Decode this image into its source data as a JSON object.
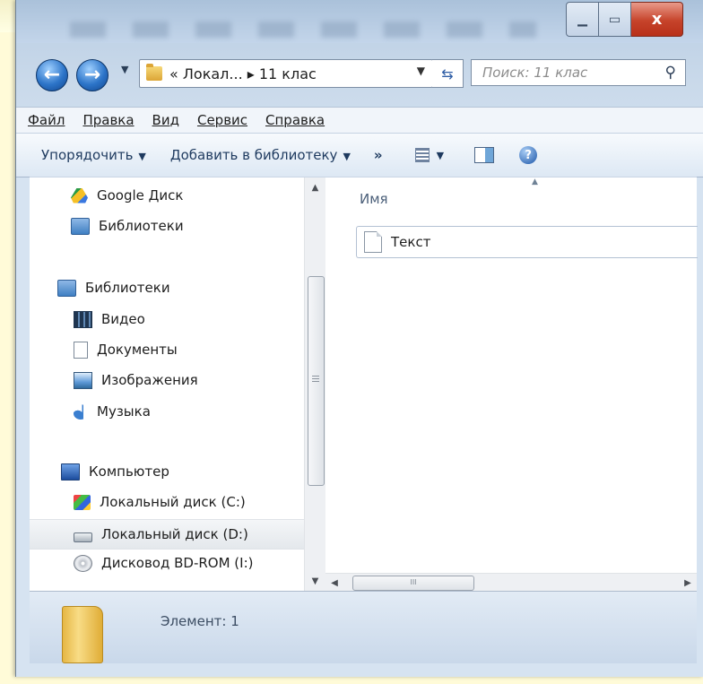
{
  "window": {
    "controls": {
      "minimize_icon": "minimize-icon",
      "maximize_icon": "maximize-icon",
      "close": "x"
    }
  },
  "navigation": {
    "back_icon": "back-arrow-icon",
    "forward_icon": "forward-arrow-icon",
    "address": "« Локал... ▸ 11 клас",
    "search_placeholder": "Поиск: 11 клас"
  },
  "menubar": {
    "items": [
      "Файл",
      "Правка",
      "Вид",
      "Сервис",
      "Справка"
    ]
  },
  "toolbar": {
    "organize": "Упорядочить",
    "add_to_library": "Добавить в библиотеку",
    "more": "»"
  },
  "navpane": {
    "items": [
      {
        "label": "Google Диск",
        "icon": "google-drive-icon"
      },
      {
        "label": "Библиотеки",
        "icon": "libraries-icon"
      },
      {
        "label": "Библиотеки",
        "icon": "libraries-icon"
      },
      {
        "label": "Видео",
        "icon": "video-icon"
      },
      {
        "label": "Документы",
        "icon": "documents-icon"
      },
      {
        "label": "Изображения",
        "icon": "pictures-icon"
      },
      {
        "label": "Музыка",
        "icon": "music-icon"
      },
      {
        "label": "Компьютер",
        "icon": "computer-icon"
      },
      {
        "label": "Локальный диск (C:)",
        "icon": "windows-drive-icon"
      },
      {
        "label": "Локальный диск (D:)",
        "icon": "drive-icon",
        "selected": true
      },
      {
        "label": "Дисковод BD-ROM (I:)",
        "icon": "optical-drive-icon"
      }
    ]
  },
  "filepane": {
    "column_name": "Имя",
    "files": [
      {
        "name": "Текст",
        "icon": "text-file-icon"
      }
    ],
    "hscroll_grip": "III"
  },
  "details": {
    "text": "Элемент: 1"
  }
}
